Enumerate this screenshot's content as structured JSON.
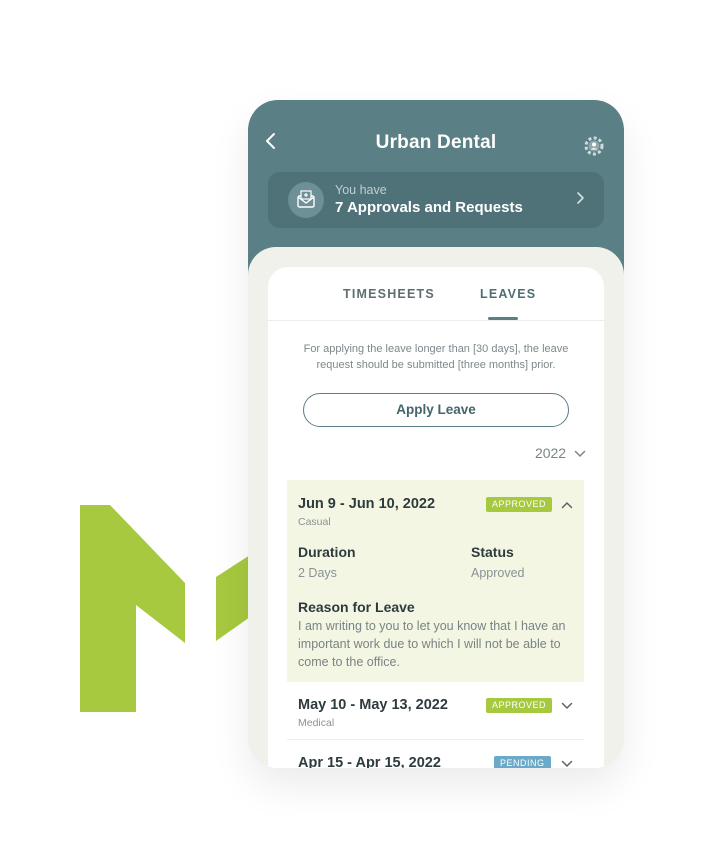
{
  "header": {
    "title": "Urban Dental",
    "back_icon": "chevron-left-icon",
    "settings_icon": "gear-icon"
  },
  "approvals": {
    "kicker": "You have",
    "text": "7 Approvals and Requests"
  },
  "tabs": [
    {
      "label": "TIMESHEETS",
      "active": false
    },
    {
      "label": "LEAVES",
      "active": true
    }
  ],
  "notice": "For applying the leave longer than [30 days], the leave request should be submitted [three months] prior.",
  "apply_button": "Apply Leave",
  "year_filter": "2022",
  "leaves": [
    {
      "dates": "Jun 9 - Jun 10, 2022",
      "type": "Casual",
      "status_badge": "APPROVED",
      "expanded": true,
      "duration_label": "Duration",
      "duration_value": "2 Days",
      "status_label": "Status",
      "status_value": "Approved",
      "reason_label": "Reason for Leave",
      "reason": "I am writing to you to let you know that I have an important work due to which I will not be able to come to the office."
    },
    {
      "dates": "May 10 - May 13, 2022",
      "type": "Medical",
      "status_badge": "APPROVED",
      "expanded": false
    },
    {
      "dates": "Apr 15 - Apr 15, 2022",
      "type": "",
      "status_badge": "PENDING",
      "expanded": false
    }
  ],
  "colors": {
    "header": "#5a7f85",
    "approved": "#a6c93f",
    "pending": "#6aa9c7",
    "logo": "#a6c93f",
    "expanded_bg": "#f3f6e3"
  }
}
